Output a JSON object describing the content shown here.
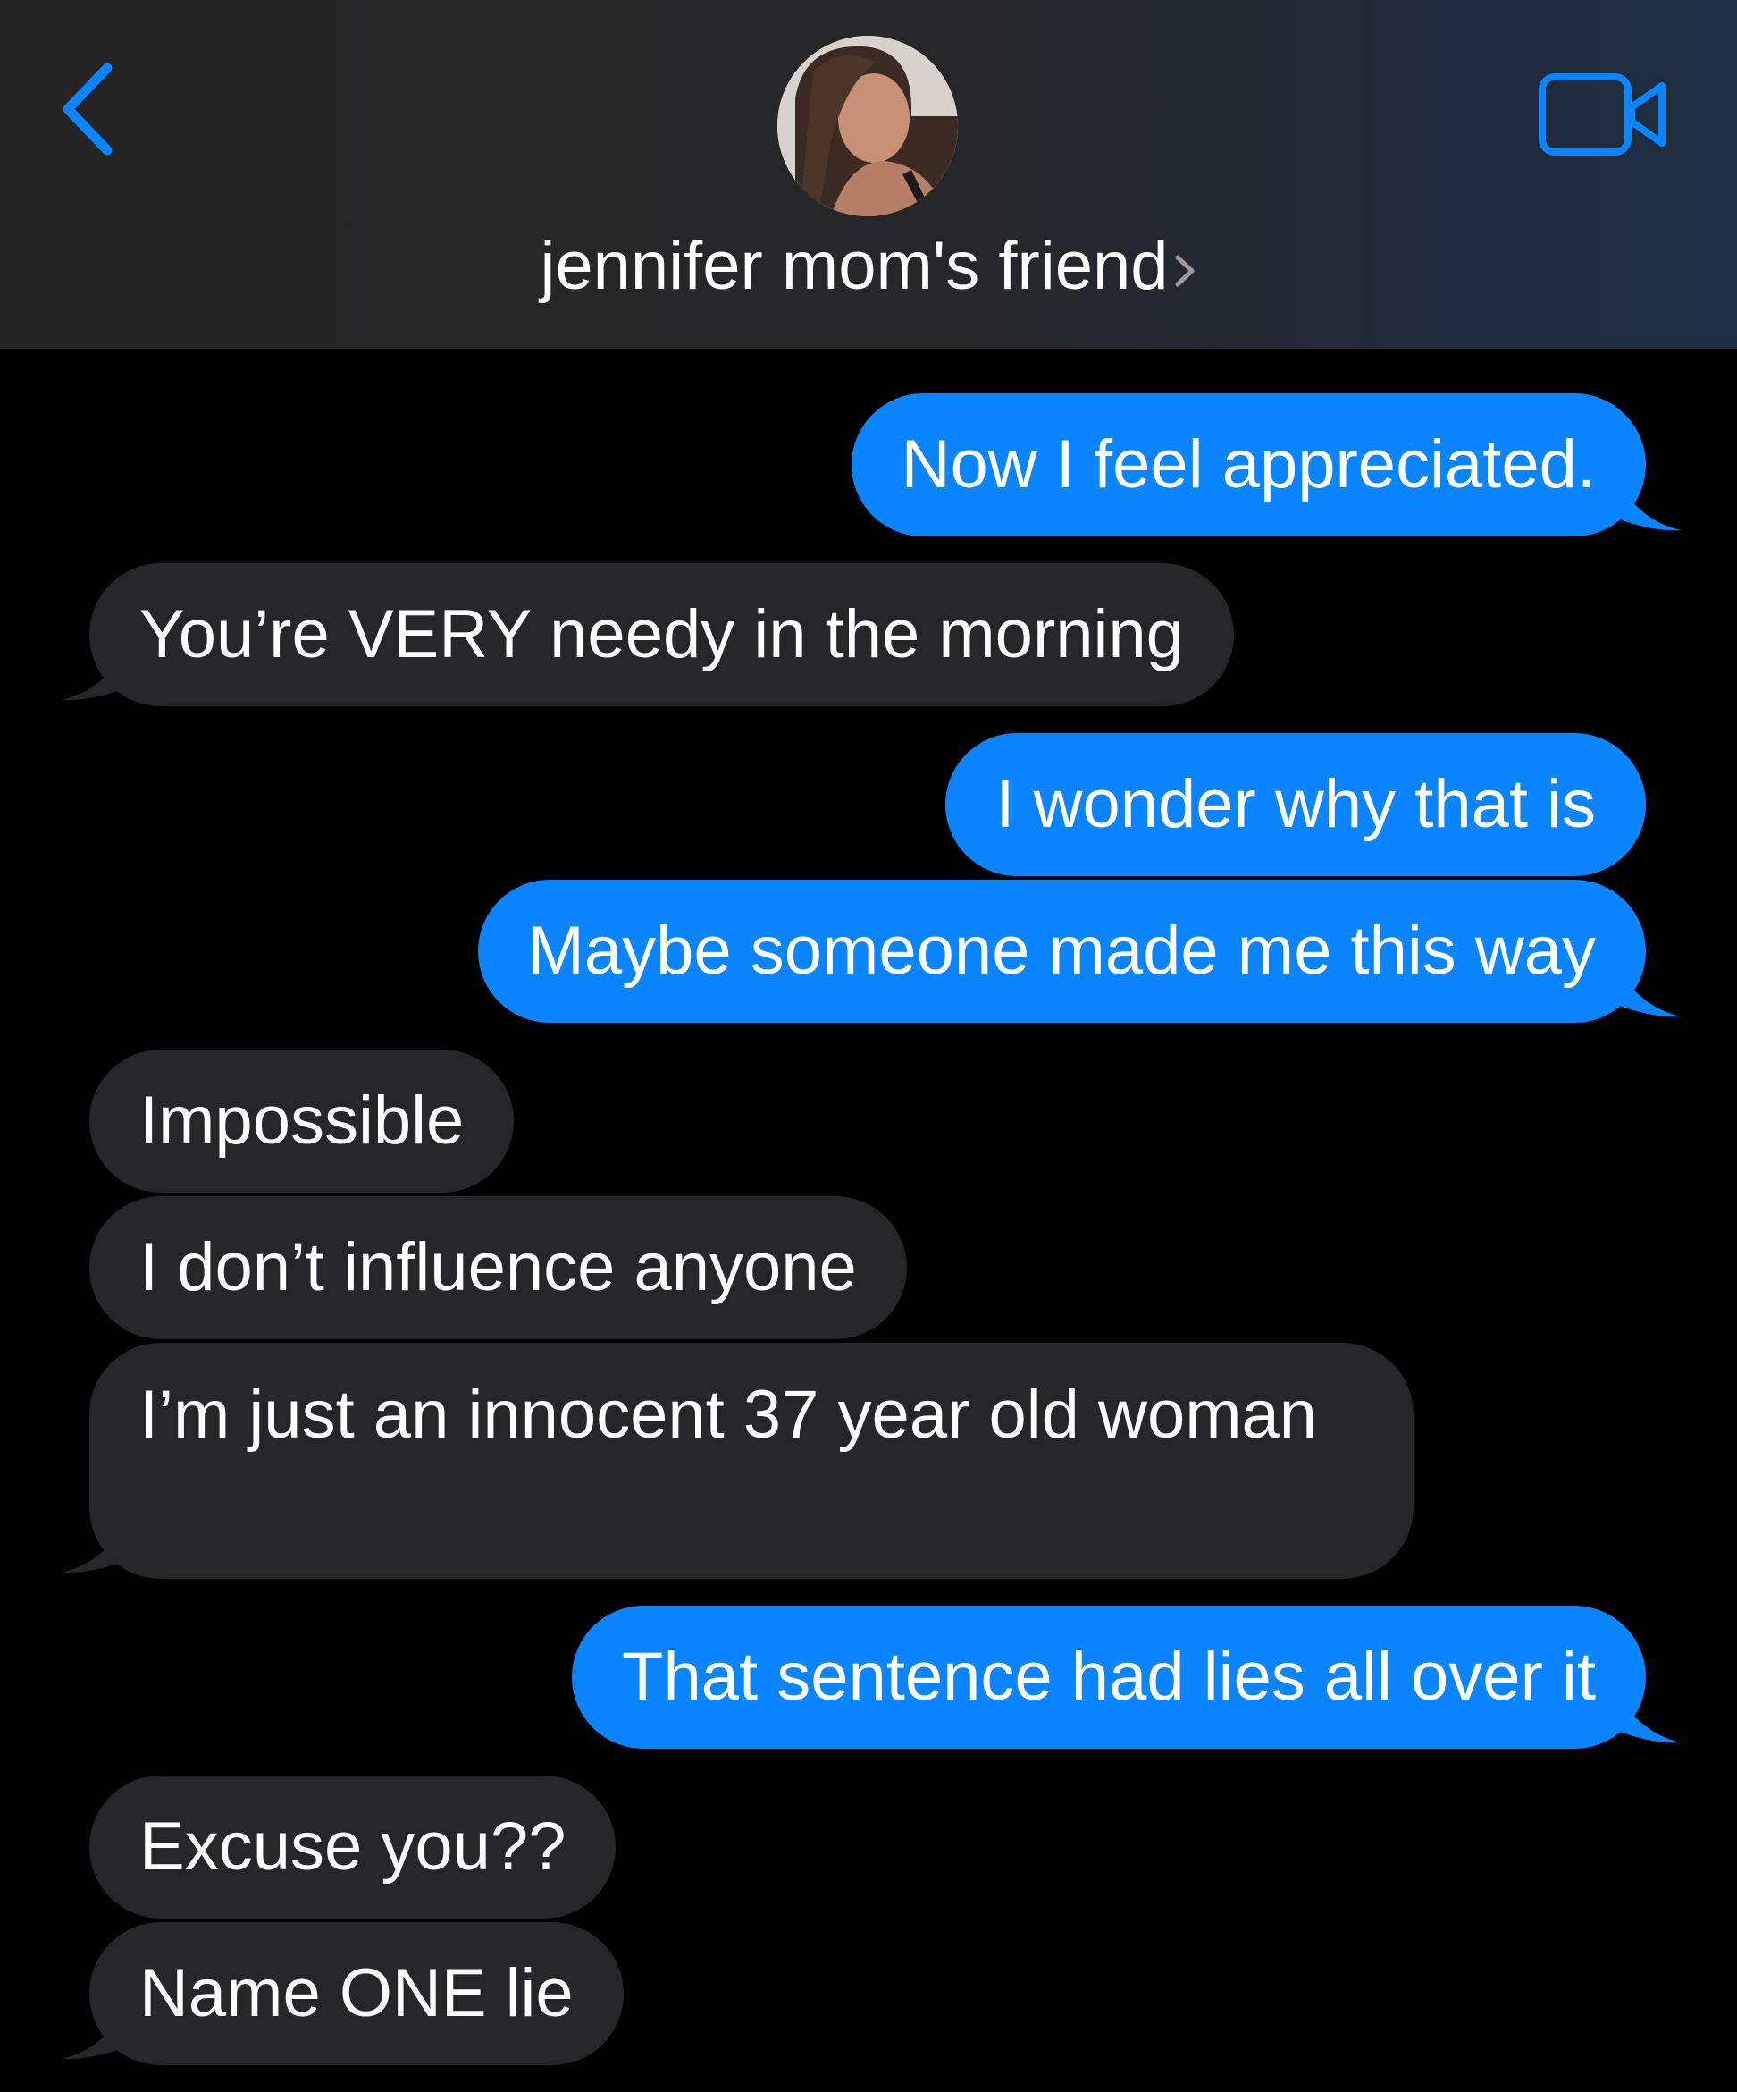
{
  "header": {
    "contact_name": "jennifer mom's friend",
    "back_icon": "chevron-left-icon",
    "video_icon": "video-camera-icon",
    "accent_color": "#0a84ff"
  },
  "messages": [
    {
      "direction": "sent",
      "text": "Now I feel appreciated."
    },
    {
      "direction": "received",
      "text": "You’re VERY needy in the morning"
    },
    {
      "direction": "sent",
      "text": "I wonder why that is"
    },
    {
      "direction": "sent",
      "text": "Maybe someone made me this way"
    },
    {
      "direction": "received",
      "text": "Impossible"
    },
    {
      "direction": "received",
      "text": "I don’t influence anyone"
    },
    {
      "direction": "received",
      "text": "I’m just an innocent 37 year old woman"
    },
    {
      "direction": "sent",
      "text": "That sentence had lies all over it"
    },
    {
      "direction": "received",
      "text": "Excuse you??"
    },
    {
      "direction": "received",
      "text": "Name ONE lie"
    }
  ],
  "colors": {
    "sent_bubble": "#0a84ff",
    "received_bubble": "#262629",
    "background": "#000000"
  }
}
